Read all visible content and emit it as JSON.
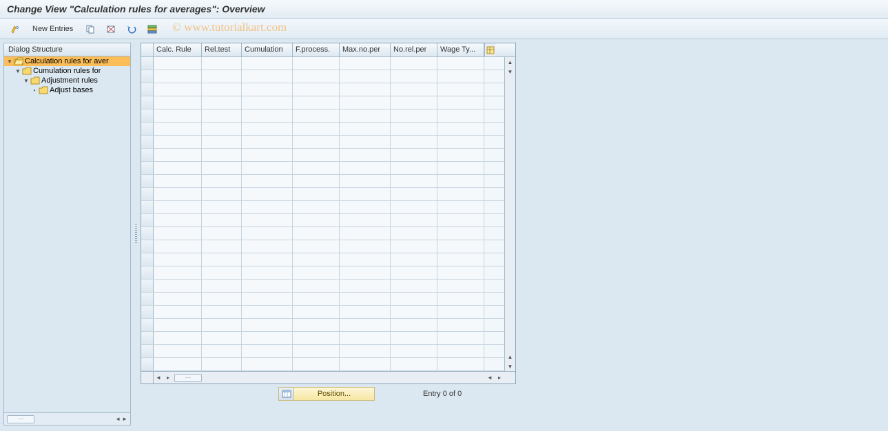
{
  "title": "Change View \"Calculation rules for averages\": Overview",
  "watermark": "© www.tutorialkart.com",
  "toolbar": {
    "new_entries": "New Entries"
  },
  "sidebar": {
    "header": "Dialog Structure",
    "items": [
      {
        "label": "Calculation rules for aver",
        "level": 0,
        "open": true,
        "selected": true
      },
      {
        "label": "Cumulation rules for",
        "level": 1,
        "open": true,
        "selected": false
      },
      {
        "label": "Adjustment rules",
        "level": 2,
        "open": true,
        "selected": false
      },
      {
        "label": "Adjust bases",
        "level": 3,
        "open": false,
        "selected": false
      }
    ]
  },
  "grid": {
    "columns": [
      "Calc. Rule",
      "Rel.test",
      "Cumulation",
      "F.process.",
      "Max.no.per",
      "No.rel.per",
      "Wage Ty..."
    ],
    "row_count": 24
  },
  "footer": {
    "position_label": "Position...",
    "entry_status": "Entry 0 of 0"
  }
}
